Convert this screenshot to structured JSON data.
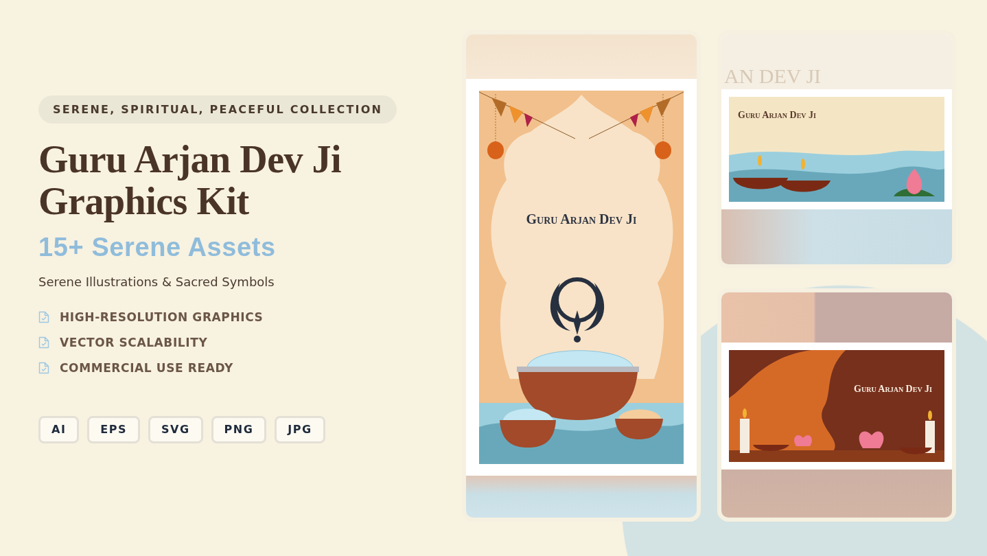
{
  "collection_tag": "SERENE, SPIRITUAL, PEACEFUL COLLECTION",
  "title": "Guru Arjan Dev Ji Graphics Kit",
  "subtitle": "15+ Serene Assets",
  "tagline": "Serene Illustrations & Sacred Symbols",
  "features": [
    "HIGH-RESOLUTION GRAPHICS",
    "VECTOR SCALABILITY",
    "COMMERCIAL USE READY"
  ],
  "formats": [
    "AI",
    "EPS",
    "SVG",
    "PNG",
    "JPG"
  ],
  "previews": [
    {
      "kind": "portrait",
      "title": "Guru Arjan Dev Ji"
    },
    {
      "kind": "water-banner",
      "faded_title": "AN DEV JI",
      "title": "Guru Arjan Dev Ji"
    },
    {
      "kind": "sunset-banner",
      "title": "Guru Arjan Dev Ji"
    }
  ]
}
